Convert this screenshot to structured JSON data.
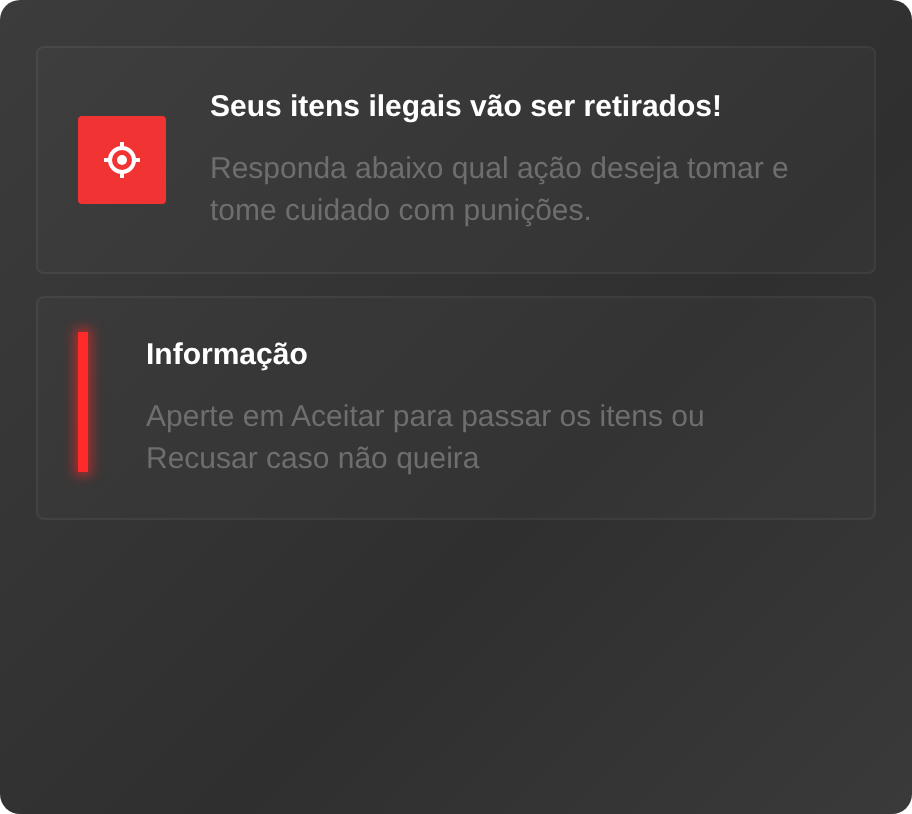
{
  "notifications": [
    {
      "kind": "icon",
      "title": "Seus itens ilegais vão ser retirados!",
      "message": "Responda abaixo qual ação deseja tomar e tome cuidado com punições."
    },
    {
      "kind": "bar",
      "title": "Informação",
      "message": "Aperte em Aceitar para passar os itens ou Recusar caso não queira"
    }
  ]
}
